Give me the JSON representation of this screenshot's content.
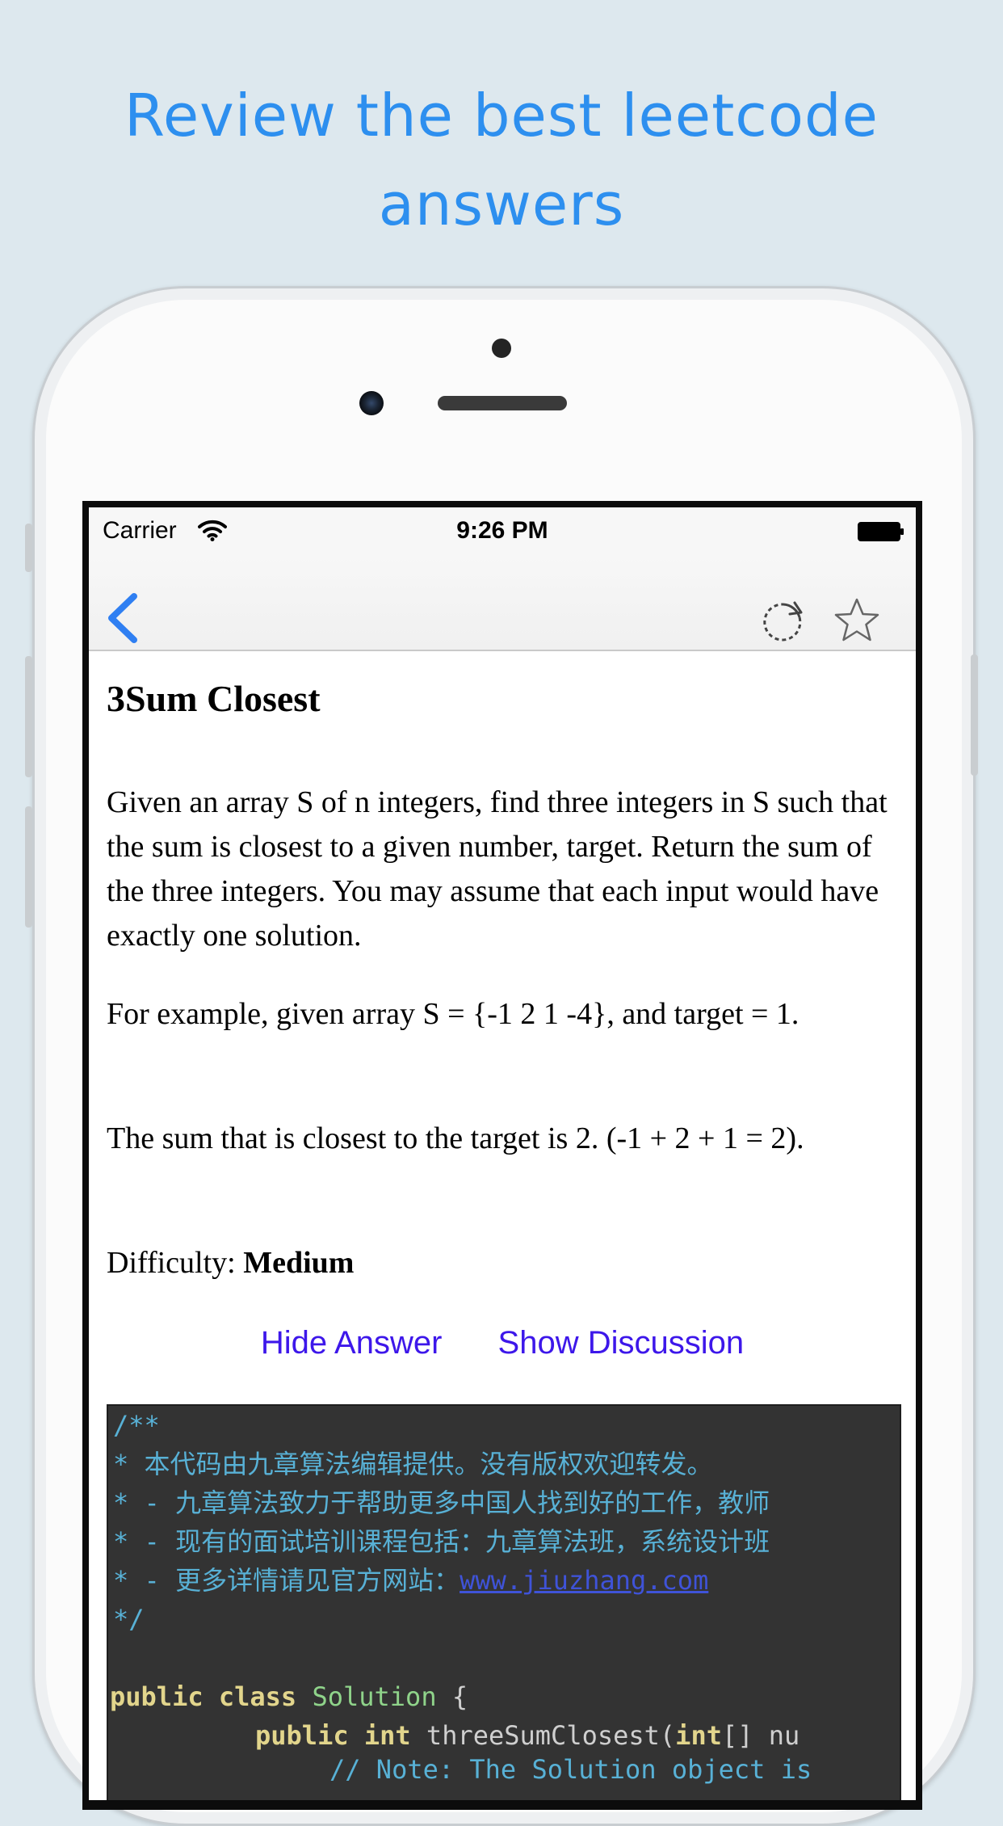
{
  "headline": {
    "line1": "Review the best leetcode",
    "line2": "answers"
  },
  "status_bar": {
    "carrier": "Carrier",
    "time": "9:26 PM"
  },
  "nav": {
    "back_icon": "chevron-left-icon",
    "refresh_icon": "refresh-icon",
    "favorite_icon": "star-outline-icon",
    "accent_color": "#2f7ff2"
  },
  "problem": {
    "title": "3Sum Closest",
    "description": "Given an array S of n integers, find three integers in S such that the sum is closest to a given number, target. Return the sum of the three integers. You may assume that each input would have exactly one solution.",
    "example": "For example, given array S = {-1 2 1 -4}, and target = 1.",
    "explanation": "The sum that is closest to the target is 2. (-1 + 2 + 1 = 2).",
    "difficulty_label": "Difficulty:",
    "difficulty_value": "Medium"
  },
  "actions": {
    "hide_answer": "Hide Answer",
    "show_discussion": "Show Discussion",
    "link_color": "#3d17ea"
  },
  "code": {
    "comment_open": "/**",
    "comment_line1": "* 本代码由九章算法编辑提供。没有版权欢迎转发。",
    "comment_line2": "* - 九章算法致力于帮助更多中国人找到好的工作，教师",
    "comment_line3": "* - 现有的面试培训课程包括：九章算法班，系统设计班",
    "comment_line4_prefix": "* - 更多详情请见官方网站：",
    "comment_line4_link": "www.jiuzhang.com",
    "comment_close": "*/",
    "class_kw1": "public",
    "class_kw2": "class",
    "class_name": "Solution",
    "class_brace": "{",
    "method_kw1": "public",
    "method_kw2": "int",
    "method_name": "threeSumClosest(",
    "param_type": "int",
    "param_rest": "[] nu",
    "note_line": "// Note: The Solution object is",
    "background_color": "#333333"
  }
}
